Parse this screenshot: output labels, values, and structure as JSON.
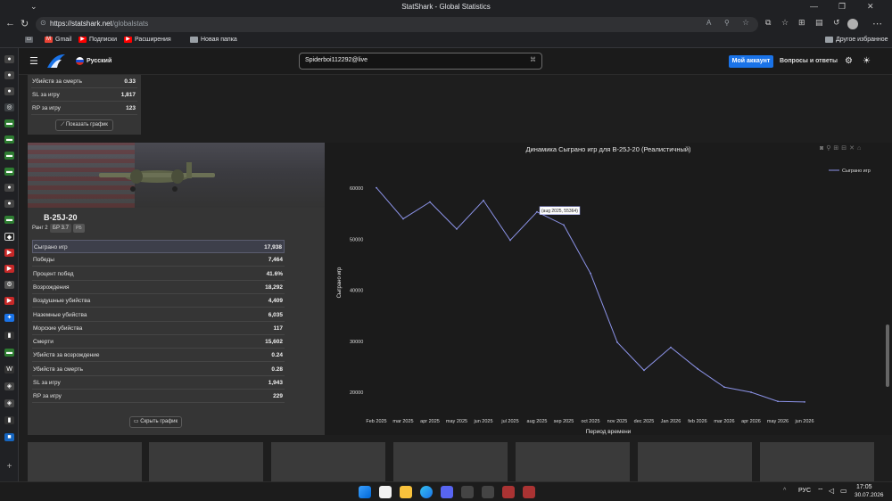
{
  "browser": {
    "window_title": "StatShark - Global Statistics",
    "url_host": "https://statshark.net",
    "url_path": "/globalstats",
    "bookmarks": [
      {
        "label": "Gmail",
        "icon": "gmail-icon",
        "color": "#ea4335"
      },
      {
        "label": "Подписки",
        "icon": "youtube-icon",
        "color": "#ff0000"
      },
      {
        "label": "Расширения",
        "icon": "youtube-icon",
        "color": "#ff0000"
      },
      {
        "label": "Новая папка",
        "icon": "folder-icon",
        "color": "#9aa0a6"
      }
    ],
    "other_bookmarks": "Другое избранное"
  },
  "site": {
    "language": "Русский",
    "search_value": "Spiderboi112292@live",
    "account_button": "Мой аккаунт",
    "faq_button": "Вопросы и ответы",
    "accent": "#1a73e8"
  },
  "top_panel": {
    "rows": [
      {
        "key": "Убийств за смерть",
        "value": "0.33"
      },
      {
        "key": "SL за игру",
        "value": "1,817"
      },
      {
        "key": "RP за игру",
        "value": "123"
      }
    ],
    "show_chart_button": "Показать график"
  },
  "vehicle": {
    "name": "B-25J-20",
    "rank": "Ранг 2",
    "br": "БР 3.7",
    "badge": "РБ",
    "rows": [
      {
        "key": "Сыграно игр",
        "value": "17,938"
      },
      {
        "key": "Победы",
        "value": "7,464"
      },
      {
        "key": "Процент побед",
        "value": "41.6%"
      },
      {
        "key": "Возрождения",
        "value": "18,292"
      },
      {
        "key": "Воздушные убийства",
        "value": "4,409"
      },
      {
        "key": "Наземные убийства",
        "value": "6,035"
      },
      {
        "key": "Морские убийства",
        "value": "117"
      },
      {
        "key": "Смерти",
        "value": "15,602"
      },
      {
        "key": "Убийств за возрождение",
        "value": "0.24"
      },
      {
        "key": "Убийств за смерть",
        "value": "0.28"
      },
      {
        "key": "SL за игру",
        "value": "1,943"
      },
      {
        "key": "RP за игру",
        "value": "229"
      }
    ],
    "hide_chart_button": "Скрыть график"
  },
  "chart_data": {
    "type": "line",
    "title": "Динамика Сыграно игр для B-25J-20 (Реалистичный)",
    "xlabel": "Период времени",
    "ylabel": "Сыграно игр",
    "legend": "top-right",
    "grid": false,
    "categories": [
      "Feb 2025",
      "mar 2025",
      "apr 2025",
      "may 2025",
      "jun 2025",
      "jul 2025",
      "aug 2025",
      "sep 2025",
      "oct 2025",
      "nov 2025",
      "dec 2025",
      "Jan 2026",
      "feb 2026",
      "mar 2026",
      "apr 2026",
      "may 2026",
      "jun 2026"
    ],
    "series": [
      {
        "name": "Сыграно игр",
        "color": "#8c93e8",
        "values": [
          60100,
          54000,
          57300,
          52000,
          57600,
          49800,
          55364,
          52800,
          43300,
          29800,
          24300,
          28800,
          24600,
          21000,
          20000,
          18200,
          18100
        ]
      }
    ],
    "point_count_x": [
      0,
      0.5,
      1,
      1.5,
      2,
      2.5,
      3,
      3.5,
      4,
      4.5,
      5,
      5.5,
      6,
      6.5,
      7,
      7.5,
      8,
      8.5,
      9,
      9.5,
      10,
      10.5,
      11,
      11.5,
      12,
      12.5,
      13,
      13.5,
      14,
      14.5,
      15,
      15.5,
      16
    ],
    "yticks": [
      20000,
      30000,
      40000,
      50000,
      60000
    ],
    "ylim": [
      16500,
      63000
    ],
    "tooltip": "(aug 2025, 55364)"
  },
  "taskbar": {
    "lang": "РУС",
    "time": "17:05",
    "date": "30.07.2026"
  }
}
